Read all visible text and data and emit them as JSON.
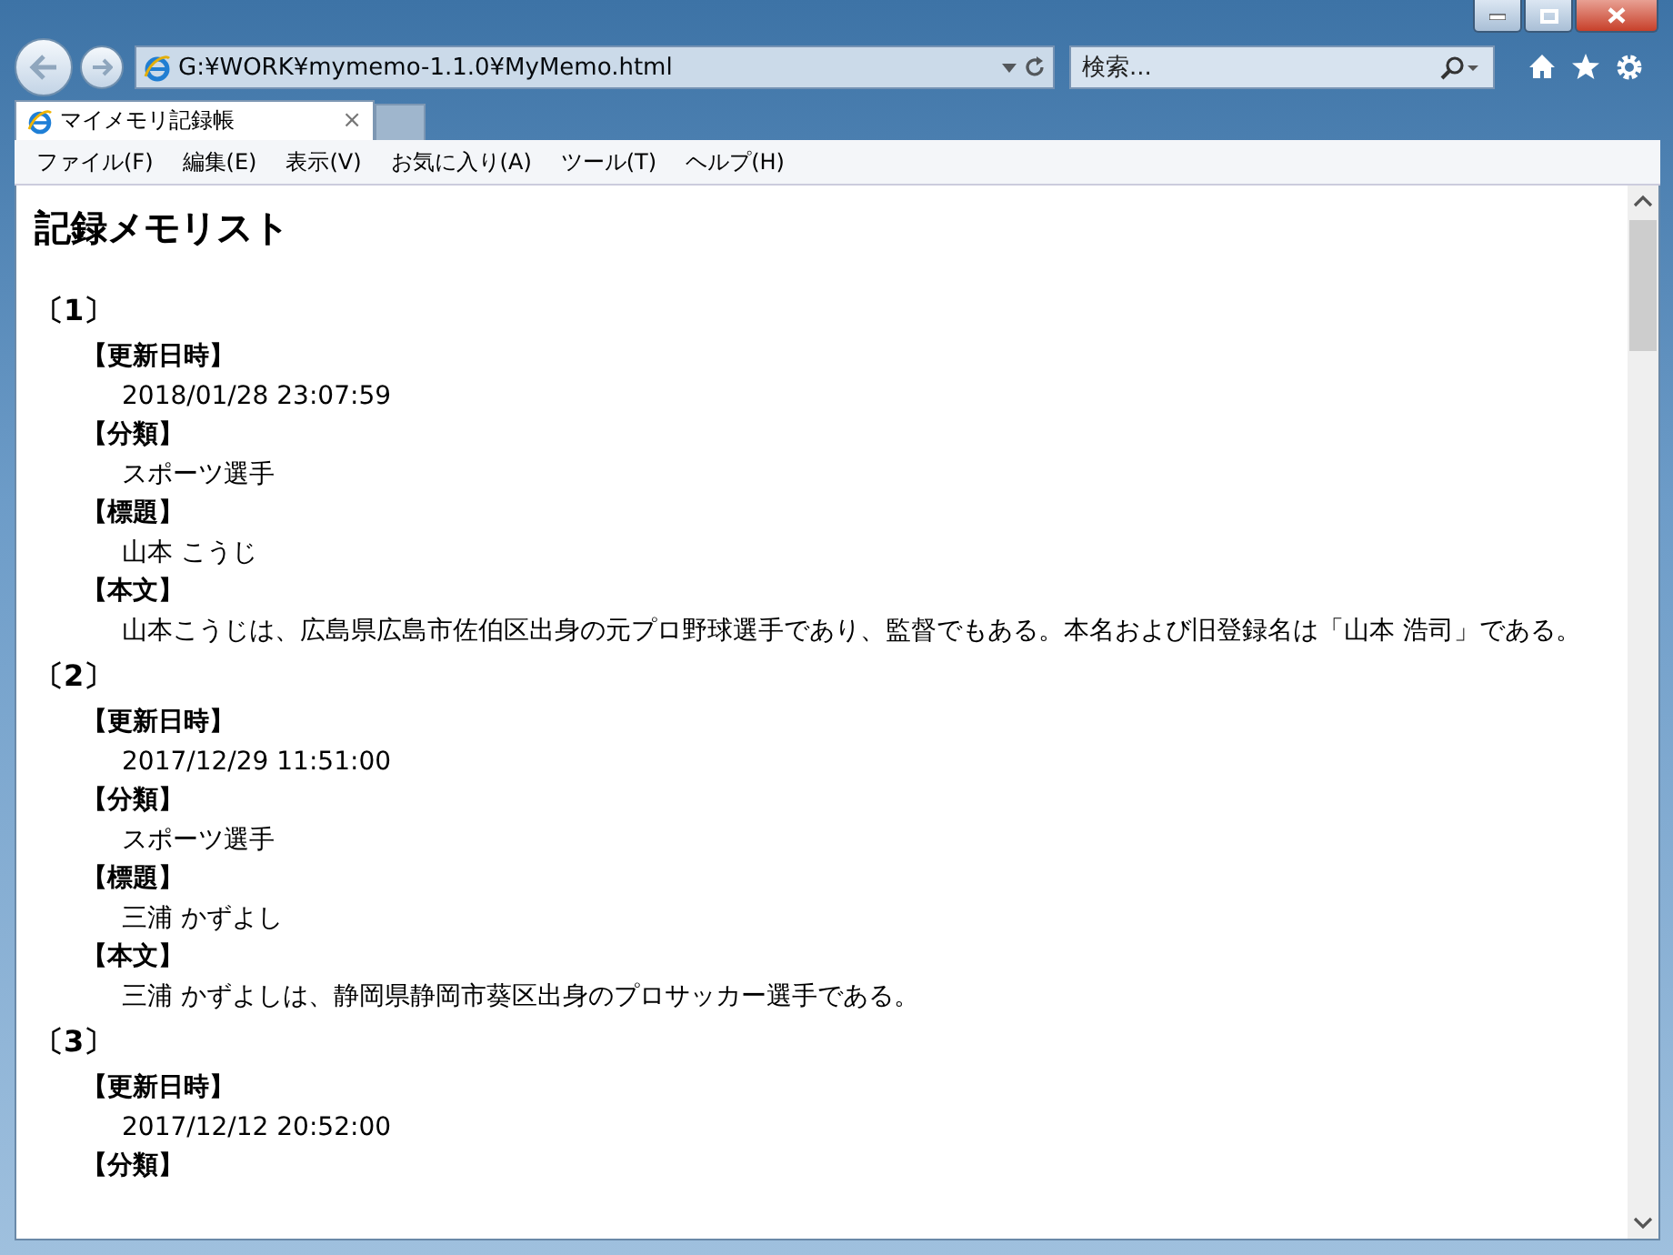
{
  "address_bar": {
    "url": "G:¥WORK¥mymemo-1.1.0¥MyMemo.html"
  },
  "search": {
    "placeholder": "検索..."
  },
  "tabs": [
    {
      "label": "マイメモリ記録帳",
      "selected": true,
      "close": "×"
    }
  ],
  "menu": [
    "ファイル(F)",
    "編集(E)",
    "表示(V)",
    "お気に入り(A)",
    "ツール(T)",
    "ヘルプ(H)"
  ],
  "page": {
    "heading": "記録メモリスト",
    "memos": [
      {
        "number": "〔1〕",
        "fields": [
          {
            "label": "【更新日時】",
            "value": "2018/01/28 23:07:59"
          },
          {
            "label": "【分類】",
            "value": "スポーツ選手"
          },
          {
            "label": "【標題】",
            "value": "山本 こうじ"
          },
          {
            "label": "【本文】",
            "value": "山本こうじは、広島県広島市佐伯区出身の元プロ野球選手であり、監督でもある。本名および旧登録名は「山本 浩司」である。"
          }
        ]
      },
      {
        "number": "〔2〕",
        "fields": [
          {
            "label": "【更新日時】",
            "value": "2017/12/29 11:51:00"
          },
          {
            "label": "【分類】",
            "value": "スポーツ選手"
          },
          {
            "label": "【標題】",
            "value": "三浦 かずよし"
          },
          {
            "label": "【本文】",
            "value": "三浦 かずよしは、静岡県静岡市葵区出身のプロサッカー選手である。"
          }
        ]
      },
      {
        "number": "〔3〕",
        "fields": [
          {
            "label": "【更新日時】",
            "value": "2017/12/12 20:52:00"
          },
          {
            "label": "【分類】"
          }
        ]
      }
    ]
  }
}
